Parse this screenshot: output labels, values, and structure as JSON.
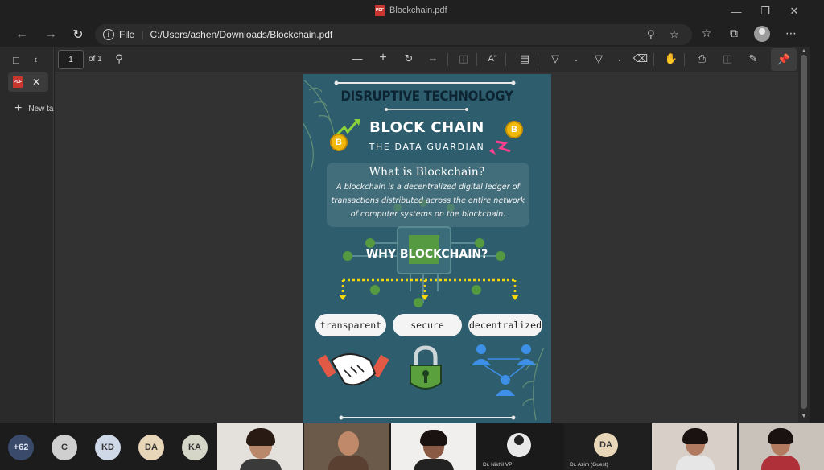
{
  "window": {
    "title": "Blockchain.pdf"
  },
  "address_bar": {
    "scheme_label": "File",
    "url": "C:/Users/ashen/Downloads/Blockchain.pdf"
  },
  "sidebar": {
    "new_tab_label": "New ta"
  },
  "pdf_toolbar": {
    "page_number": "1",
    "page_total": "of 1"
  },
  "poster": {
    "heading": "DISRUPTIVE TECHNOLOGY",
    "title": "BLOCK CHAIN",
    "tagline": "THE DATA GUARDIAN",
    "what_title": "What is Blockchain?",
    "what_text": "A blockchain is a decentralized digital ledger of transactions distributed across the entire network of computer systems on the blockchain.",
    "why_title": "WHY BLOCKCHAIN?",
    "pills": [
      "transparent",
      "secure",
      "decentralized"
    ],
    "coin_symbol": "B",
    "colors": {
      "background": "#2e5d6e",
      "heading": "#0d2432",
      "accent_yellow": "#f5d90a",
      "node_green": "#5aa03c"
    }
  },
  "meeting": {
    "bubbles": [
      {
        "label": "+62",
        "bg": "#3a4a6a",
        "fg": "#dfe6f5"
      },
      {
        "label": "C",
        "bg": "#cfcfcf",
        "fg": "#333333"
      },
      {
        "label": "KD",
        "bg": "#cfd8e6",
        "fg": "#333333"
      },
      {
        "label": "DA",
        "bg": "#e8d6b8",
        "fg": "#333333"
      },
      {
        "label": "KA",
        "bg": "#d6d6c8",
        "fg": "#333333"
      }
    ],
    "tiles": [
      {
        "name": ""
      },
      {
        "name": ""
      },
      {
        "name": ""
      },
      {
        "name": "Dr. Nikhil VP"
      },
      {
        "name": "Dr. Azim (Guest)",
        "initials": "DA"
      },
      {
        "name": ""
      },
      {
        "name": ""
      }
    ]
  }
}
